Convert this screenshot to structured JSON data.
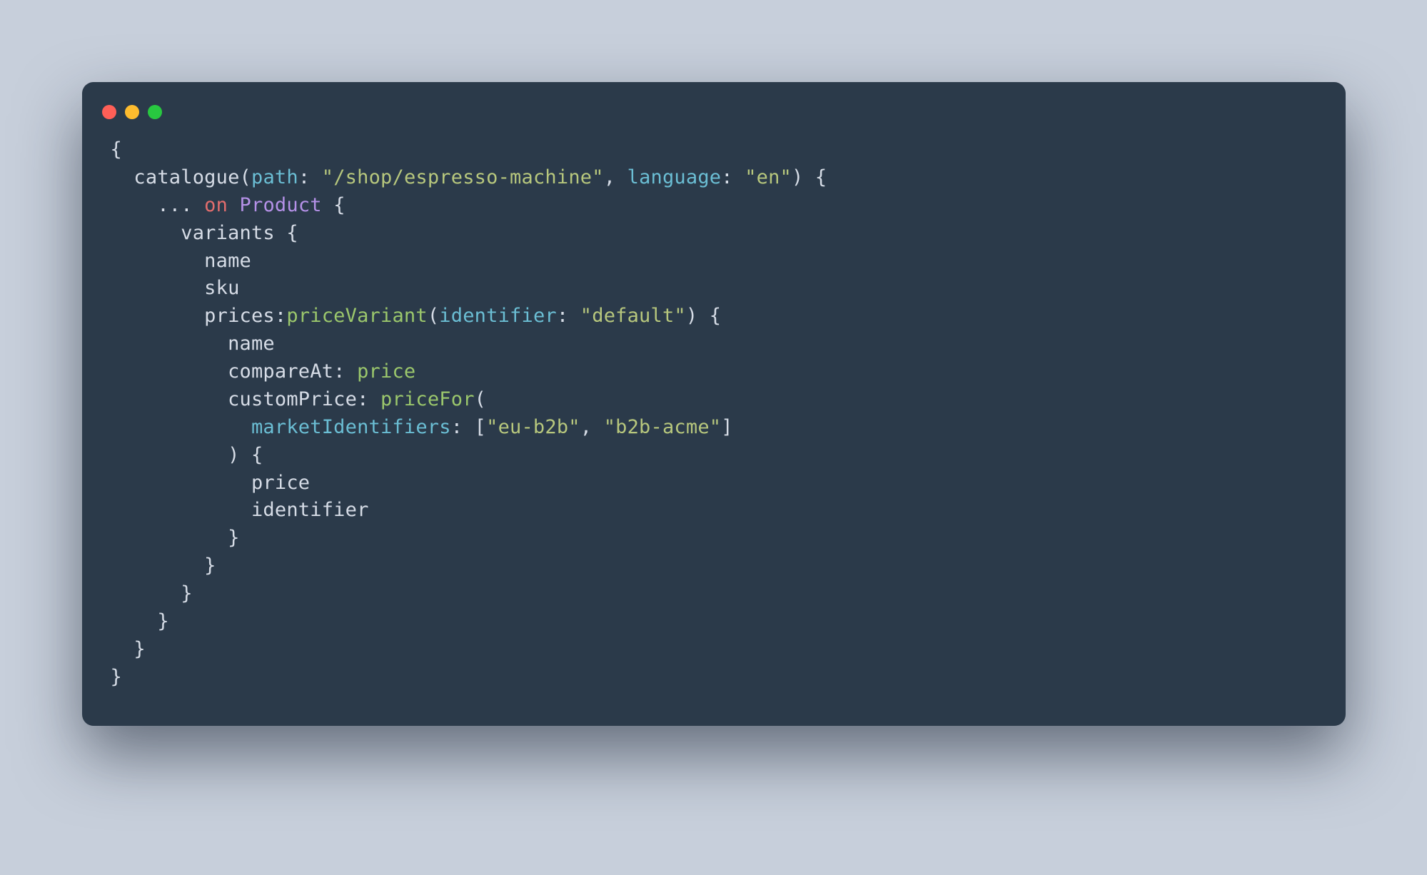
{
  "colors": {
    "bg_page": "#c7cfdb",
    "bg_window": "#2b3a4a",
    "text": "#d6dce6",
    "arg": "#6bbed4",
    "string": "#b7c77d",
    "keyword": "#e26d6d",
    "type": "#b591e8",
    "alias_target": "#9bc76c",
    "dot_red": "#ff5f57",
    "dot_yellow": "#febc2e",
    "dot_green": "#28c840"
  },
  "code": {
    "l1_open": "{",
    "l2_fn": "catalogue",
    "l2_lp": "(",
    "l2_arg1": "path",
    "l2_colon1": ": ",
    "l2_str1": "\"/shop/espresso-machine\"",
    "l2_comma": ", ",
    "l2_arg2": "language",
    "l2_colon2": ": ",
    "l2_str2": "\"en\"",
    "l2_rp_brace": ") {",
    "l3_spread": "... ",
    "l3_on": "on",
    "l3_sp": " ",
    "l3_type": "Product",
    "l3_brace": " {",
    "l4_variants": "variants {",
    "l5_name": "name",
    "l6_sku": "sku",
    "l7_alias": "prices",
    "l7_colon": ":",
    "l7_target": "priceVariant",
    "l7_lp": "(",
    "l7_arg": "identifier",
    "l7_argcolon": ": ",
    "l7_str": "\"default\"",
    "l7_rp_brace": ") {",
    "l8_name": "name",
    "l9_alias": "compareAt",
    "l9_colon": ": ",
    "l9_target": "price",
    "l10_alias": "customPrice",
    "l10_colon": ": ",
    "l10_target": "priceFor",
    "l10_lp": "(",
    "l11_arg": "marketIdentifiers",
    "l11_colon": ": ",
    "l11_lb": "[",
    "l11_s1": "\"eu-b2b\"",
    "l11_comma": ", ",
    "l11_s2": "\"b2b-acme\"",
    "l11_rb": "]",
    "l12_rp_brace": ") {",
    "l13_price": "price",
    "l14_ident": "identifier",
    "l15_close": "}",
    "l16_close": "}",
    "l17_close": "}",
    "l18_close": "}",
    "l19_close": "}",
    "l20_close": "}"
  },
  "indent": {
    "i1": "  ",
    "i2": "    ",
    "i3": "      ",
    "i4": "        ",
    "i5": "          ",
    "i6": "            ",
    "i7": "              "
  }
}
